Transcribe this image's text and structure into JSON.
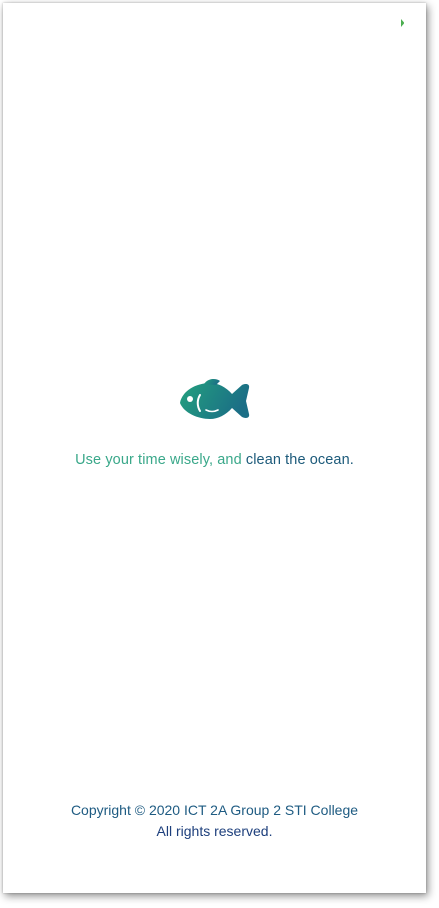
{
  "tagline": {
    "part_a": "Use your time wisely, and",
    "part_b": "clean the ocean."
  },
  "footer": {
    "copyright": "Copyright © 2020 ICT 2A Group 2 STI College",
    "rights": "All rights reserved."
  },
  "icons": {
    "logo": "fish-icon",
    "status": "battery-indicator-icon"
  },
  "colors": {
    "fish_gradient_start": "#23a07e",
    "fish_gradient_end": "#1b6e86",
    "tagline_primary": "#3aa88a",
    "tagline_secondary": "#1c5a7a",
    "footer_text": "#1d3f7c",
    "status_green": "#4caf50"
  }
}
